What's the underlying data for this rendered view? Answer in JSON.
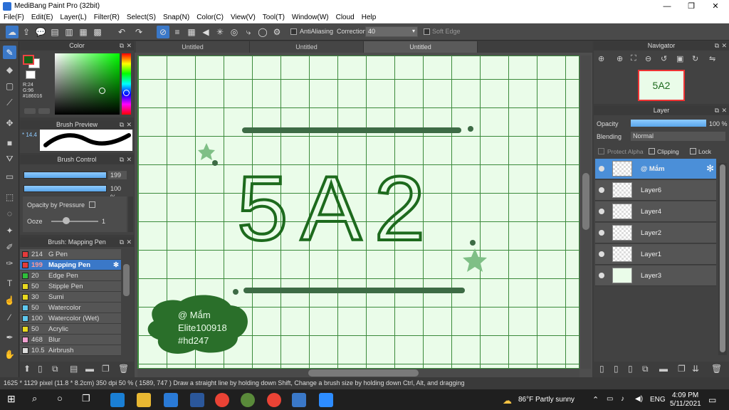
{
  "window": {
    "title": "MediBang Paint Pro (32bit)",
    "min": "—",
    "max": "❐",
    "close": "✕"
  },
  "menu": [
    "File(F)",
    "Edit(E)",
    "Layer(L)",
    "Filter(R)",
    "Select(S)",
    "Snap(N)",
    "Color(C)",
    "View(V)",
    "Tool(T)",
    "Window(W)",
    "Cloud",
    "Help"
  ],
  "toolbar": {
    "antialiasing": "AntiAliasing",
    "correction_label": "Correction",
    "correction_value": "40",
    "soft_edge": "Soft Edge"
  },
  "color_panel": {
    "title": "Color",
    "r": "R:24",
    "g": "G:96",
    "hex": "#186016",
    "main_color": "#186016"
  },
  "brush_preview": {
    "title": "Brush Preview",
    "size": "* 14.4"
  },
  "brush_control": {
    "title": "Brush Control",
    "size_value": "199",
    "opacity_value": "100 %",
    "opacity_by_pressure": "Opacity by Pressure",
    "ooze_label": "Ooze",
    "ooze_value": "1"
  },
  "brush_list": {
    "title": "Brush: Mapping Pen",
    "items": [
      {
        "size": "214",
        "name": "G Pen",
        "color": "#e43b3b"
      },
      {
        "size": "199",
        "name": "Mapping Pen",
        "color": "#e43b3b"
      },
      {
        "size": "20",
        "name": "Edge Pen",
        "color": "#2fbe3a"
      },
      {
        "size": "50",
        "name": "Stipple Pen",
        "color": "#e8d81f"
      },
      {
        "size": "30",
        "name": "Sumi",
        "color": "#e8d81f"
      },
      {
        "size": "50",
        "name": "Watercolor",
        "color": "#5fc8ef"
      },
      {
        "size": "100",
        "name": "Watercolor (Wet)",
        "color": "#5fc8ef"
      },
      {
        "size": "50",
        "name": "Acrylic",
        "color": "#e8d81f"
      },
      {
        "size": "468",
        "name": "Blur",
        "color": "#f0a0d0"
      },
      {
        "size": "10.5",
        "name": "Airbrush",
        "color": "#dddddd"
      }
    ]
  },
  "tabs": [
    "Untitled",
    "Untitled",
    "Untitled"
  ],
  "artwork": {
    "main_text": "5A2",
    "badge_lines": [
      "@ Mắm",
      "Elite100918",
      "#hd247"
    ],
    "ink": "#1d6a1d",
    "bar": "#3d6b45",
    "bg": "#eafce9"
  },
  "navigator": {
    "title": "Navigator",
    "thumb_text": "5A2"
  },
  "layer_panel": {
    "title": "Layer",
    "opacity_label": "Opacity",
    "opacity_value": "100 %",
    "blending_label": "Blending",
    "blending_value": "Normal",
    "protect_alpha": "Protect Alpha",
    "clipping": "Clipping",
    "lock": "Lock",
    "layers": [
      "@ Mắm",
      "Layer6",
      "Layer4",
      "Layer2",
      "Layer1",
      "Layer3"
    ]
  },
  "status": {
    "text": "1625 * 1129 pixel  (11.8 * 8.2cm)  350 dpi  50 %  ( 1589, 747 )  Draw a straight line by holding down Shift, Change a brush size by holding down Ctrl, Alt, and dragging"
  },
  "taskbar": {
    "weather": "86°F  Partly sunny",
    "lang": "ENG",
    "time": "4:09 PM",
    "date": "5/11/2021"
  }
}
